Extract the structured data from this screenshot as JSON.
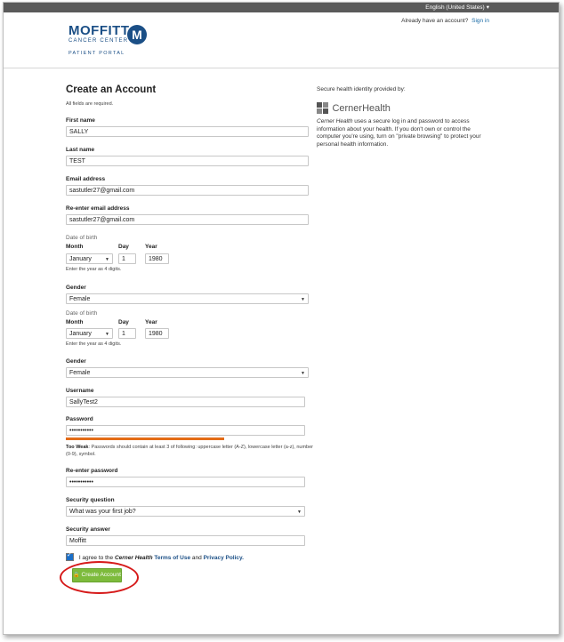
{
  "header": {
    "language": "English (United States)",
    "account_prompt": "Already have an account?",
    "sign_in": "Sign in"
  },
  "logo": {
    "name": "MOFFITT",
    "mark": "M",
    "subtitle": "CANCER CENTER",
    "portal": "PATIENT PORTAL"
  },
  "form": {
    "title": "Create an Account",
    "required_note": "All fields are required.",
    "first_name_label": "First name",
    "first_name": "SALLY",
    "last_name_label": "Last name",
    "last_name": "TEST",
    "email_label": "Email address",
    "email": "sastutler27@gmail.com",
    "email2_label": "Re-enter email address",
    "email2": "sastutler27@gmail.com",
    "dob1": {
      "section": "Date of birth",
      "month_label": "Month",
      "day_label": "Day",
      "year_label": "Year",
      "month": "January",
      "day": "1",
      "year": "1980",
      "hint": "Enter the year as 4 digits."
    },
    "gender1_label": "Gender",
    "gender1": "Female",
    "dob2": {
      "section": "Date of birth",
      "month_label": "Month",
      "day_label": "Day",
      "year_label": "Year",
      "month": "January",
      "day": "1",
      "year": "1980",
      "hint": "Enter the year as 4 digits."
    },
    "gender2_label": "Gender",
    "gender2": "Female",
    "username_label": "Username",
    "username": "SallyTest2",
    "password_label": "Password",
    "password": "•••••••••••",
    "password_strength_label": "Too Weak",
    "password_strength_text": "Passwords should contain at least 3 of following: uppercase letter (A-Z), lowercase letter (a-z), number (0-9), symbol.",
    "password2_label": "Re-enter password",
    "password2": "•••••••••••",
    "security_question_label": "Security question",
    "security_question": "What was your first job?",
    "security_answer_label": "Security answer",
    "security_answer": "Moffitt",
    "agree_prefix": "I agree to the",
    "agree_brand": "Cerner Health",
    "terms": "Terms of Use",
    "agree_and": "and",
    "privacy": "Privacy Policy.",
    "submit": "Create Account"
  },
  "side": {
    "provided_by": "Secure health identity provided by:",
    "cerner_logo": "CernerHealth",
    "desc_brand": "Cerner Health",
    "description": "uses a secure log in and password to access information about your health. If you don't own or control the computer you're using, turn on \"private browsing\" to protect your personal health information."
  },
  "colors": {
    "brand_blue": "#1b4f86",
    "button_green": "#7dbb3c",
    "strength_orange": "#e36b16",
    "annotation_red": "#d61a1a"
  }
}
